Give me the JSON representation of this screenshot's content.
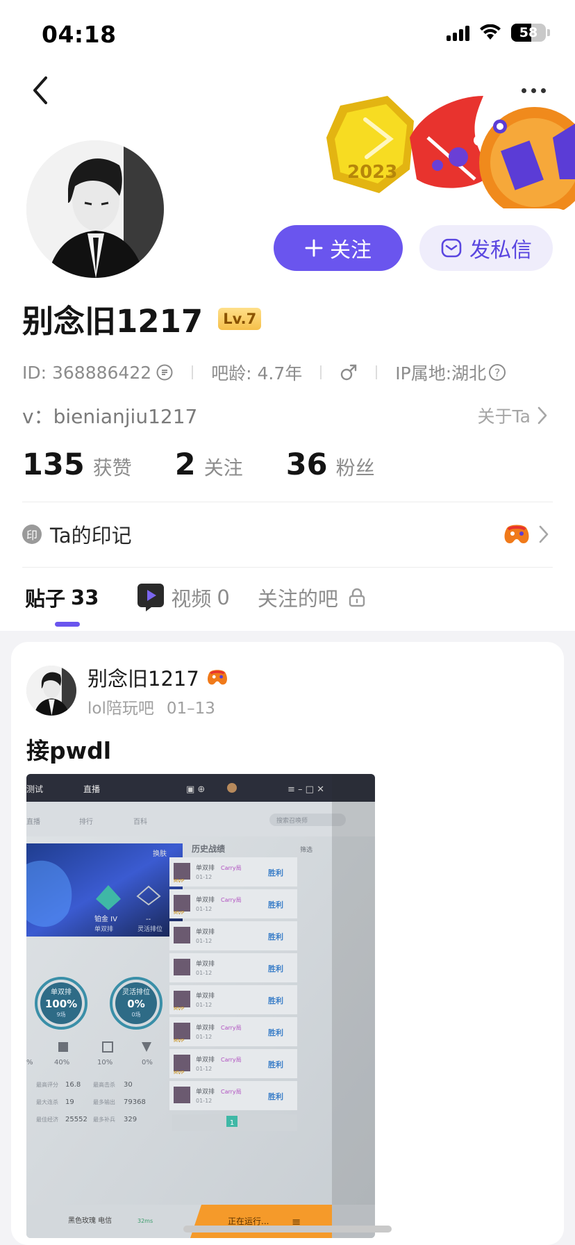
{
  "status_bar": {
    "time": "04:18",
    "battery": "58",
    "battery_level": 0.58
  },
  "nav": {
    "back_icon": "chevron-left-icon",
    "more_icon": "more-dots-icon"
  },
  "profile": {
    "name": "别念旧1217",
    "level": "Lv.7",
    "id_text": "ID: 368886422",
    "age_text": "吧龄: 4.7年",
    "gender_icon": "male-icon",
    "ip_text": "IP属地:湖北",
    "v_text": "v：bienianjiu1217",
    "about_label": "关于Ta"
  },
  "actions": {
    "follow_label": "关注",
    "message_label": "发私信"
  },
  "stats": [
    {
      "num": "135",
      "label": "获赞"
    },
    {
      "num": "2",
      "label": "关注"
    },
    {
      "num": "36",
      "label": "粉丝"
    }
  ],
  "yinji": {
    "icon_text": "印",
    "label": "Ta的印记"
  },
  "tabs": [
    {
      "label": "贴子",
      "count": "33"
    },
    {
      "label": "视频",
      "count": "0"
    },
    {
      "label": "关注的吧"
    }
  ],
  "post": {
    "author": "别念旧1217",
    "forum": "lol陪玩吧",
    "date": "01–13",
    "title": "接pwdl"
  },
  "screenshot_text": {
    "tab_test": "测试",
    "tab_live": "直播",
    "search_placeholder": "搜索召唤师",
    "nav_1": "直播",
    "nav_2": "排行",
    "nav_3": "百科",
    "history": "历史战绩",
    "skin": "换肤",
    "filter": "筛选",
    "rank1_label": "铂金 IV",
    "rank1_sub": "单双排",
    "rank2_label": "--",
    "rank2_sub": "灵活排位",
    "circle1_label": "单双排",
    "circle1_value": "100%",
    "circle1_sub": "9场",
    "circle2_label": "灵活排位",
    "circle2_value": "0%",
    "circle2_sub": "0场",
    "pcts": [
      "%",
      "40%",
      "10%",
      "0%"
    ],
    "stats_rows": [
      [
        "最高评分",
        "16.8",
        "最高击杀",
        "30"
      ],
      [
        "最大连杀",
        "19",
        "最多输出",
        "79368"
      ],
      [
        "最佳经济",
        "25552",
        "最多补兵",
        "329"
      ]
    ],
    "matches": [
      {
        "mode": "单双排",
        "tag": "Carry局",
        "date": "01-12",
        "result": "胜利",
        "mvp": "MVP"
      },
      {
        "mode": "单双排",
        "tag": "Carry局",
        "date": "01-12",
        "result": "胜利",
        "mvp": "MVP"
      },
      {
        "mode": "单双排",
        "tag": "",
        "date": "01-12",
        "result": "胜利",
        "mvp": ""
      },
      {
        "mode": "单双排",
        "tag": "",
        "date": "01-12",
        "result": "胜利",
        "mvp": ""
      },
      {
        "mode": "单双排",
        "tag": "",
        "date": "01-12",
        "result": "胜利",
        "mvp": "MVP"
      },
      {
        "mode": "单双排",
        "tag": "Carry局",
        "date": "01-12",
        "result": "胜利",
        "mvp": "MVP"
      },
      {
        "mode": "单双排",
        "tag": "Carry局",
        "date": "01-12",
        "result": "胜利",
        "mvp": "MVP"
      },
      {
        "mode": "单双排",
        "tag": "Carry局",
        "date": "01-12",
        "result": "胜利",
        "mvp": ""
      }
    ],
    "page": "1",
    "bottom_server": "黑色玫瑰 电信",
    "ping": "32ms",
    "running": "正在运行..."
  },
  "colors": {
    "accent": "#6a55ee",
    "accent_light": "#efedfb",
    "level_badge": "#f5c04a"
  }
}
